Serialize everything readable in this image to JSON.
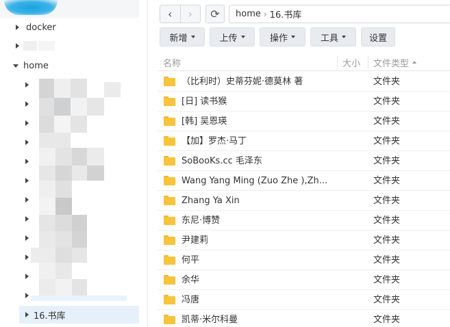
{
  "sidebar": {
    "items": [
      {
        "label": "docker"
      },
      {
        "label": "home"
      },
      {
        "label": "16.书库"
      }
    ]
  },
  "nav": {
    "back_icon": "‹",
    "forward_icon": "›",
    "refresh_icon": "⟳",
    "path": [
      "home",
      "16.书库"
    ],
    "path_separator": "›"
  },
  "toolbar": {
    "new_label": "新增",
    "upload_label": "上传",
    "action_label": "操作",
    "tools_label": "工具",
    "settings_label": "设置"
  },
  "table": {
    "columns": [
      "名称",
      "大小",
      "文件类型"
    ],
    "rows": [
      {
        "name": "（比利时）史蒂芬妮·德莫林 著",
        "type": "文件夹"
      },
      {
        "name": "[日] 读书猴",
        "type": "文件夹"
      },
      {
        "name": "[韩] 吴恩瑛",
        "type": "文件夹"
      },
      {
        "name": "【加】罗杰·马丁",
        "type": "文件夹"
      },
      {
        "name": "SoBooKs.cc 毛泽东",
        "type": "文件夹"
      },
      {
        "name": "Wang Yang Ming (Zuo Zhe ),Zh...",
        "type": "文件夹"
      },
      {
        "name": "Zhang Ya Xin",
        "type": "文件夹"
      },
      {
        "name": "东尼·博赞",
        "type": "文件夹"
      },
      {
        "name": "尹建莉",
        "type": "文件夹"
      },
      {
        "name": "何平",
        "type": "文件夹"
      },
      {
        "name": "余华",
        "type": "文件夹"
      },
      {
        "name": "冯唐",
        "type": "文件夹"
      },
      {
        "name": "凯蒂·米尔科曼",
        "type": "文件夹"
      }
    ]
  },
  "colors": {
    "accent": "#1aa3e0",
    "folder": "#f8c43c",
    "selected_row": "#e6f0fb"
  }
}
